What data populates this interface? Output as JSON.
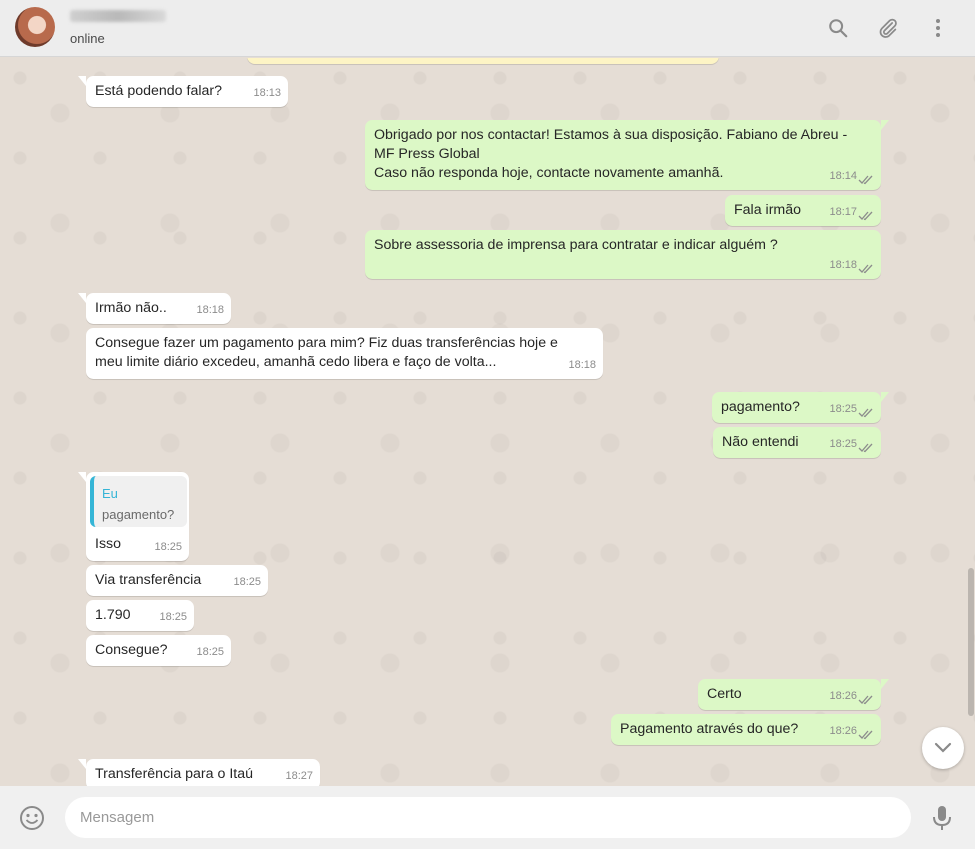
{
  "header": {
    "status": "online"
  },
  "composer": {
    "placeholder": "Mensagem"
  },
  "messages": [
    {
      "dir": "in",
      "text": "Está podendo falar?",
      "time": "18:13"
    },
    {
      "dir": "out",
      "lines": [
        "Obrigado por nos contactar! Estamos à sua disposição. Fabiano de Abreu -",
        "MF Press Global",
        "Caso não responda hoje, contacte novamente amanhã."
      ],
      "time": "18:14"
    },
    {
      "dir": "out",
      "text": "Fala irmão",
      "time": "18:17"
    },
    {
      "dir": "out",
      "text": "Sobre assessoria de imprensa para contratar e indicar alguém ?",
      "time": "18:18"
    },
    {
      "dir": "in",
      "text": "Irmão não..",
      "time": "18:18"
    },
    {
      "dir": "in",
      "lines": [
        "Consegue fazer um pagamento para mim? Fiz duas transferências hoje e",
        "meu limite diário excedeu, amanhã cedo libera e faço de volta..."
      ],
      "time": "18:18"
    },
    {
      "dir": "out",
      "text": "pagamento?",
      "time": "18:25"
    },
    {
      "dir": "out",
      "text": "Não entendi",
      "time": "18:25"
    },
    {
      "dir": "in",
      "quote": {
        "author": "Eu",
        "text": "pagamento?"
      },
      "text": "Isso",
      "time": "18:25"
    },
    {
      "dir": "in",
      "text": "Via transferência",
      "time": "18:25"
    },
    {
      "dir": "in",
      "text": "1.790",
      "time": "18:25"
    },
    {
      "dir": "in",
      "text": "Consegue?",
      "time": "18:25"
    },
    {
      "dir": "out",
      "text": "Certo",
      "time": "18:26"
    },
    {
      "dir": "out",
      "text": "Pagamento através do que?",
      "time": "18:26"
    },
    {
      "dir": "in",
      "text": "Transferência para o Itaú",
      "time": "18:27"
    }
  ],
  "icons": {
    "search": "search-icon",
    "attach": "paperclip-icon",
    "menu": "kebab-menu-icon",
    "emoji": "emoji-icon",
    "mic": "microphone-icon",
    "scroll": "chevron-down-icon",
    "read": "double-check-icon"
  },
  "colors": {
    "incoming_bubble": "#ffffff",
    "outgoing_bubble": "#dcf8c6",
    "chat_background": "#e5ddd5",
    "header_background": "#ededed",
    "read_ticks": "#8c8c8c",
    "quote_accent": "#35b5d6"
  }
}
